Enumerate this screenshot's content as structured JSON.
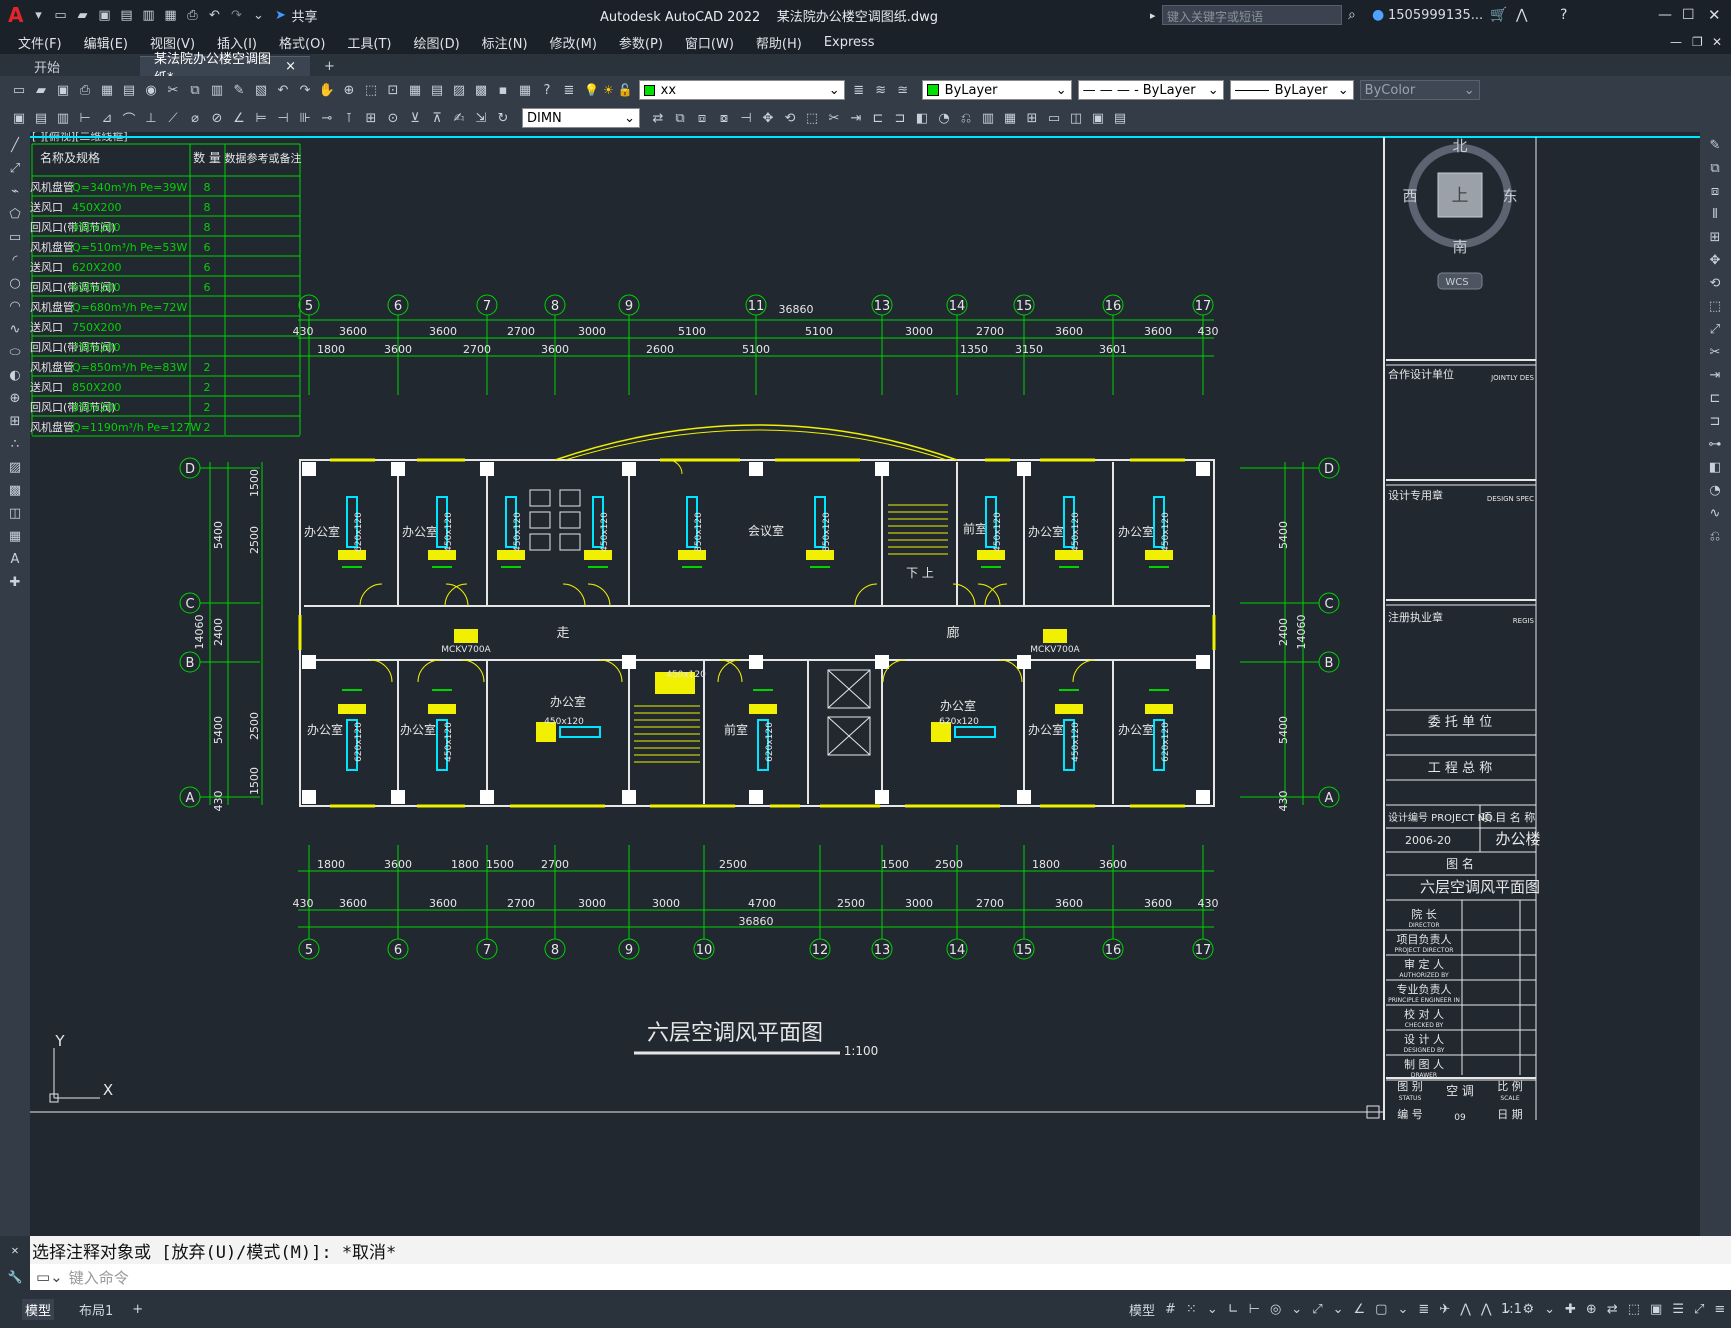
{
  "title": {
    "app": "Autodesk AutoCAD 2022",
    "file": "某法院办公楼空调图纸.dwg",
    "share": "共享",
    "search_placeholder": "键入关键字或短语",
    "user": "1505999135...",
    "logo": "A"
  },
  "menu": [
    "文件(F)",
    "编辑(E)",
    "视图(V)",
    "插入(I)",
    "格式(O)",
    "工具(T)",
    "绘图(D)",
    "标注(N)",
    "修改(M)",
    "参数(P)",
    "窗口(W)",
    "帮助(H)",
    "Express"
  ],
  "tabs": {
    "start": "开始",
    "doc": "某法院办公楼空调图纸*",
    "close": "×",
    "add": "+"
  },
  "toolbar": {
    "layer": "xx",
    "color": "ByLayer",
    "linetype": "ByLayer",
    "lineweight": "ByLayer",
    "plotstyle": "ByColor",
    "dimstyle": "DIMN",
    "ltype_dash": "— — — -"
  },
  "viewport_label": "[-][俯视][二维线框]",
  "viewcube": {
    "north": "北",
    "south": "南",
    "east": "东",
    "west": "西",
    "top": "上",
    "wcs": "WCS"
  },
  "equip_table": {
    "headers": [
      "名称及规格",
      "数 量",
      "数据参考或备注"
    ],
    "rows": [
      {
        "name": "风机盘管",
        "spec": "Q=340m³/h    Pe=39W",
        "qty": "8"
      },
      {
        "name": "送风口",
        "spec": "450X200",
        "qty": "8"
      },
      {
        "name": "回风口(带调节阀)",
        "spec": "450x200",
        "qty": "8"
      },
      {
        "name": "风机盘管",
        "spec": "Q=510m³/h    Pe=53W",
        "qty": "6"
      },
      {
        "name": "送风口",
        "spec": "620X200",
        "qty": "6"
      },
      {
        "name": "回风口(带调节阀)",
        "spec": "620x200",
        "qty": "6"
      },
      {
        "name": "风机盘管",
        "spec": "Q=680m³/h    Pe=72W",
        "qty": ""
      },
      {
        "name": "送风口",
        "spec": "750X200",
        "qty": ""
      },
      {
        "name": "回风口(带调节阀)",
        "spec": "750x200",
        "qty": ""
      },
      {
        "name": "风机盘管",
        "spec": "Q=850m³/h    Pe=83W",
        "qty": "2"
      },
      {
        "name": "送风口",
        "spec": "850X200",
        "qty": "2"
      },
      {
        "name": "回风口(带调节阀)",
        "spec": "850x200",
        "qty": "2"
      },
      {
        "name": "风机盘管",
        "spec": "Q=1190m³/h  Pe=127W",
        "qty": "2"
      }
    ]
  },
  "plan": {
    "top_axes": [
      "5",
      "6",
      "7",
      "8",
      "9",
      "11",
      "13",
      "14",
      "15",
      "16",
      "17"
    ],
    "bottom_axes": [
      "5",
      "6",
      "7",
      "8",
      "9",
      "10",
      "12",
      "13",
      "14",
      "15",
      "16",
      "17"
    ],
    "row_axes": [
      "D",
      "C",
      "B",
      "A"
    ],
    "total": "36860",
    "top_dims1": [
      "430",
      "3600",
      "3600",
      "2700",
      "3000",
      "5100",
      "5100",
      "3000",
      "2700",
      "3600",
      "3600",
      "430"
    ],
    "top_dims2": [
      "1800",
      "3600",
      "2700",
      "3600",
      "2600",
      "5100",
      "1350",
      "3150",
      "3601"
    ],
    "bottom_dims1": [
      "1800",
      "3600",
      "1800",
      "1500",
      "2700",
      "2500",
      "1500",
      "2500",
      "1800",
      "3600"
    ],
    "bottom_dims2": [
      "430",
      "3600",
      "3600",
      "2700",
      "3000",
      "3000",
      "4700",
      "2500",
      "3000",
      "2700",
      "3600",
      "3600",
      "430"
    ],
    "left_dims": [
      "1500",
      "2500",
      "5400",
      "2400",
      "14060",
      "2500",
      "1500",
      "5400",
      "430"
    ],
    "right_dims": [
      "5400",
      "2400",
      "14060",
      "5400",
      "430"
    ],
    "rooms": [
      "办公室",
      "办公室",
      "会议室",
      "前室",
      "办公室",
      "办公室",
      "办公室",
      "办公室",
      "办公室",
      "前室",
      "办公室",
      "办公室",
      "办公室"
    ],
    "corridor": [
      "走",
      "廊"
    ],
    "stair": "下 上",
    "units": [
      "MCKV700A",
      "MCKV700A"
    ],
    "duct_labels": [
      "620x120",
      "450x120",
      "450x120",
      "450x120",
      "850x120",
      "850x120",
      "450x120",
      "450x120",
      "450x120",
      "620x120",
      "450x120",
      "620x120",
      "450x120",
      "620x120",
      "450x120",
      "620x120",
      "450x120",
      "450x120"
    ],
    "title": "六层空调风平面图",
    "scale": "1:100"
  },
  "titleblock": {
    "coop": "合作设计单位",
    "coop_en": "JOINTLY DES",
    "seal": "设计专用章",
    "seal_en": "DESIGN SPEC",
    "reg": "注册执业章",
    "reg_en": "REGIS",
    "client": "委 托 单 位",
    "project": "工 程 总 称",
    "proj_no_label": "设计编号 PROJECT NO.",
    "proj_name_label": "项 目 名 称",
    "proj_no": "2006-20",
    "proj_name": "办公楼",
    "drawing_label": "图          名",
    "drawing_name": "六层空调风平面图",
    "roles": [
      "院 长",
      "项目负责人",
      "审 定 人",
      "专业负责人",
      "校 对 人",
      "设 计 人",
      "制 图 人"
    ],
    "roles_en": [
      "DIRECTOR",
      "PROJECT DIRECTOR",
      "AUTHORIZED BY",
      "PRINCIPLE ENGINEER IN",
      "CHECKED BY",
      "DESIGNED BY",
      "DRAWER"
    ],
    "status_label": "图 别",
    "status_val": "空 调",
    "scale_label": "比 例",
    "scale_en": "SCALE",
    "status_en": "STATUS",
    "num_label": "编 号",
    "date_label": "日 期",
    "num_val": "09"
  },
  "command": {
    "history": "选择注释对象或 [放弃(U)/模式(M)]: *取消*",
    "placeholder": "键入命令"
  },
  "status": {
    "model": "模型",
    "layout1": "布局1",
    "add": "+",
    "model_btn": "模型",
    "scale": "1:1"
  },
  "ucs": {
    "x": "X",
    "y": "Y"
  }
}
